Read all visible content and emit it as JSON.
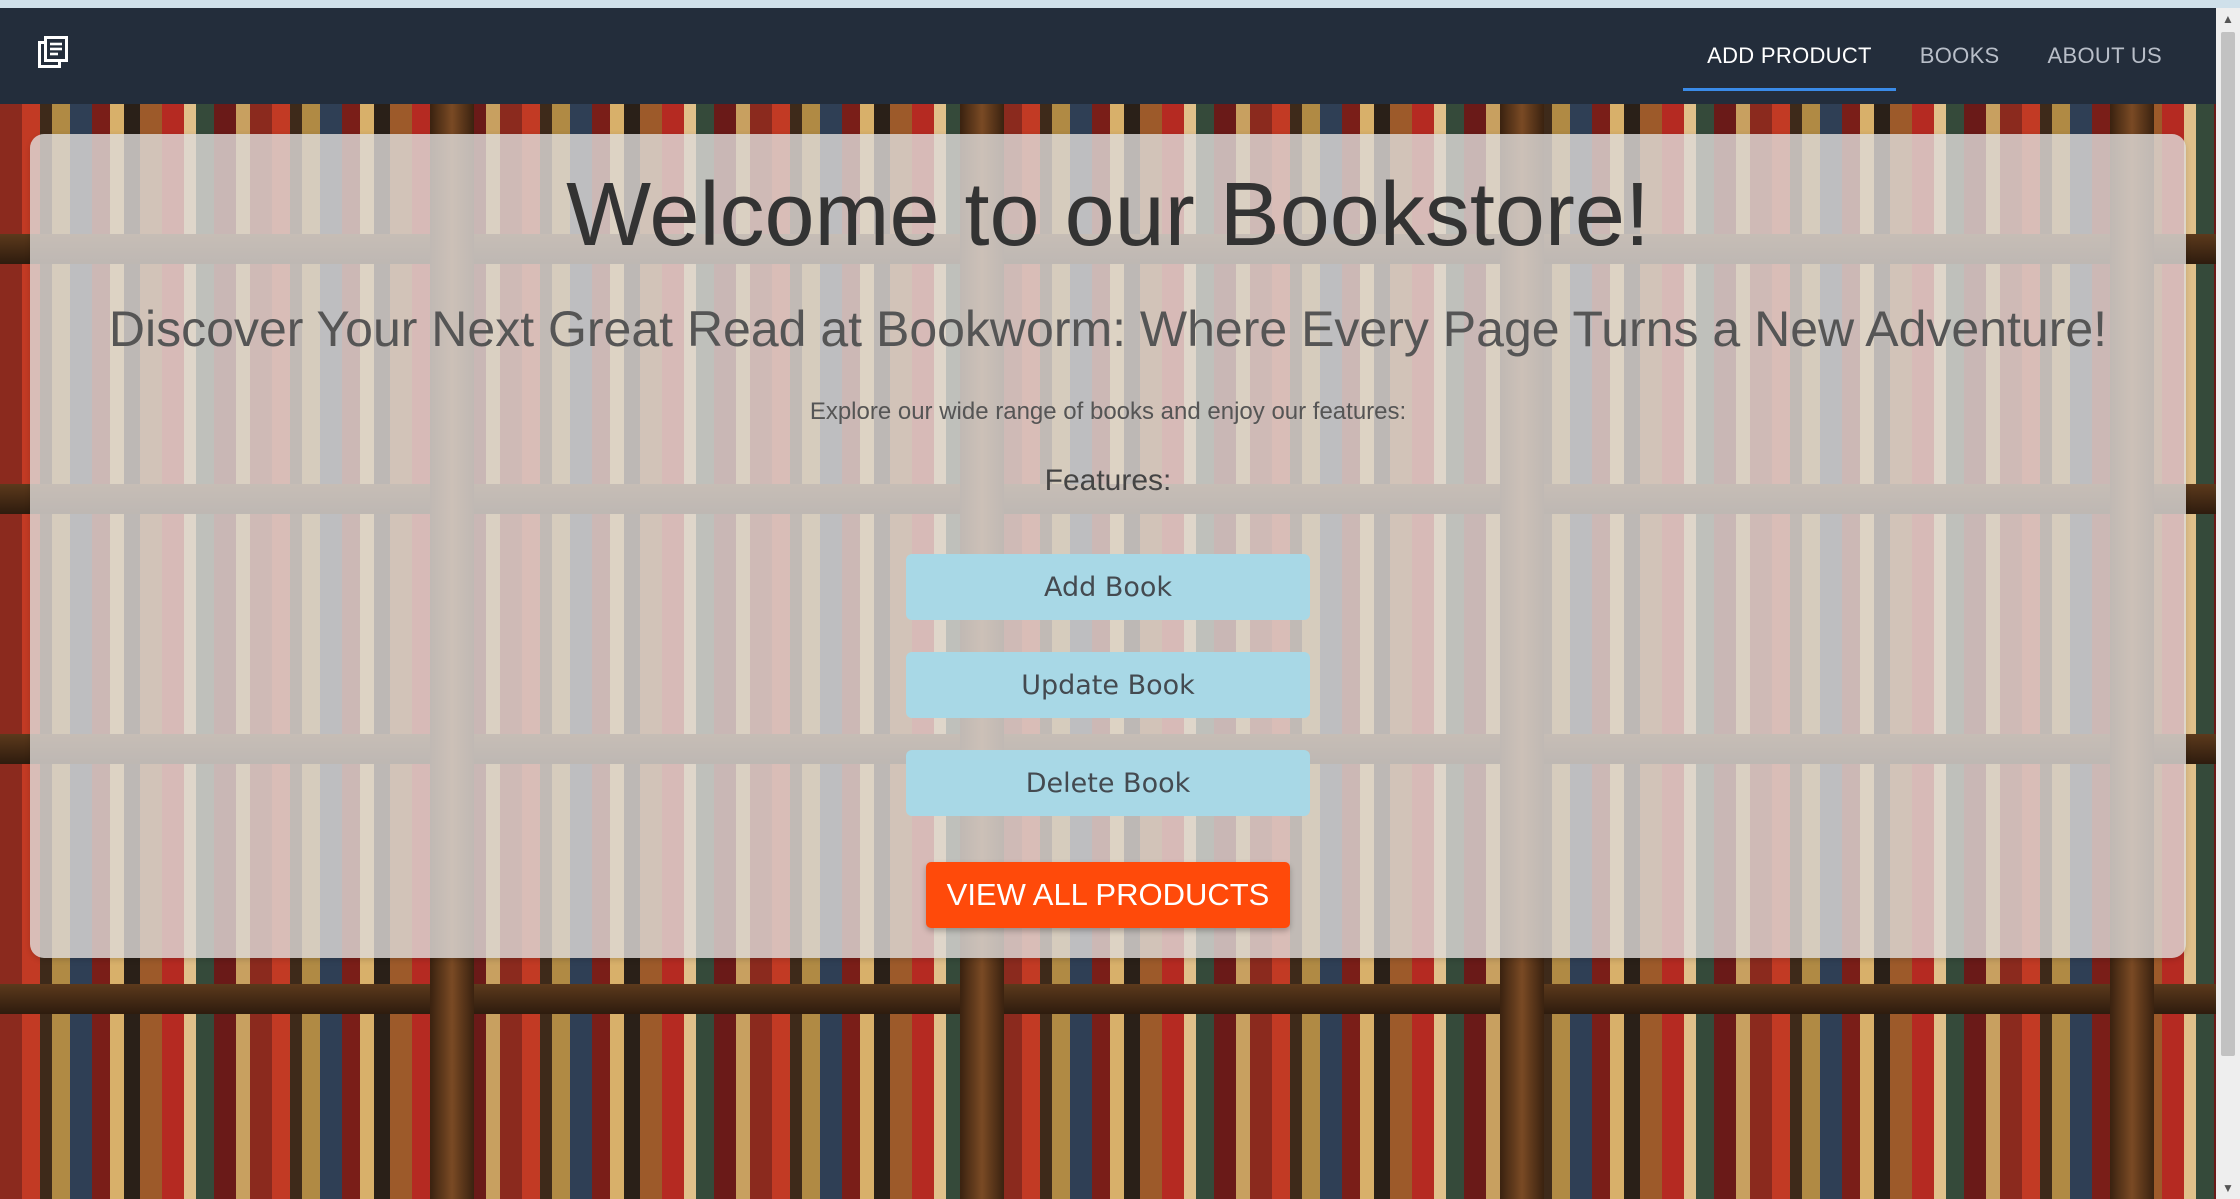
{
  "header": {
    "logo_icon": "library-books-icon",
    "nav": [
      {
        "label": "ADD PRODUCT",
        "active": true
      },
      {
        "label": "BOOKS",
        "active": false
      },
      {
        "label": "ABOUT US",
        "active": false
      }
    ]
  },
  "hero": {
    "title": "Welcome to our Bookstore!",
    "subtitle": "Discover Your Next Great Read at Bookworm: Where Every Page Turns a New Adventure!",
    "intro": "Explore our wide range of books and enjoy our features:",
    "features_heading": "Features:",
    "features": [
      {
        "label": "Add Book"
      },
      {
        "label": "Update Book"
      },
      {
        "label": "Delete Book"
      }
    ],
    "cta_label": "VIEW ALL PRODUCTS"
  },
  "colors": {
    "header_bg": "#232d3b",
    "active_underline": "#3a8be8",
    "feature_button_bg": "#a8d8e6",
    "cta_bg": "#ff4a0a"
  }
}
